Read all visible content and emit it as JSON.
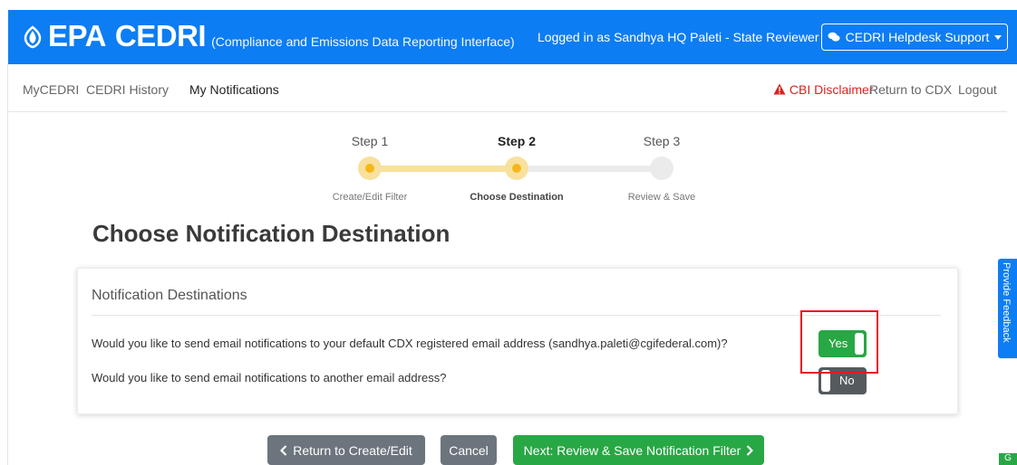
{
  "header": {
    "brand": "EPA",
    "app": "CEDRI",
    "tagline": "(Compliance and Emissions Data Reporting Interface)",
    "logged_in": "Logged in as Sandhya HQ Paleti - State Reviewer",
    "helpdesk": "CEDRI Helpdesk Support"
  },
  "nav": {
    "left": [
      "MyCEDRI",
      "CEDRI History",
      "My Notifications"
    ],
    "active": "My Notifications",
    "cbi": "CBI Disclaimer",
    "return": "Return to CDX",
    "logout": "Logout"
  },
  "stepper": {
    "steps": [
      {
        "label": "Step 1",
        "sub": "Create/Edit Filter",
        "state": "done"
      },
      {
        "label": "Step 2",
        "sub": "Choose Destination",
        "state": "active"
      },
      {
        "label": "Step 3",
        "sub": "Review & Save",
        "state": "todo"
      }
    ]
  },
  "page": {
    "title": "Choose Notification Destination"
  },
  "card": {
    "title": "Notification Destinations",
    "q1": "Would you like to send email notifications to your default CDX registered email address (sandhya.paleti@cgifederal.com)?",
    "q1_toggle": "Yes",
    "q2": "Would you like to send email notifications to another email address?",
    "q2_toggle": "No"
  },
  "buttons": {
    "back": "Return to Create/Edit",
    "cancel": "Cancel",
    "next": "Next: Review & Save Notification Filter"
  },
  "side": {
    "feedback": "Provide Feedback",
    "g": "G"
  },
  "colors": {
    "primary": "#0d7df3",
    "success": "#28a745",
    "secondary": "#6c757d",
    "danger": "#d9231f",
    "highlight": "#e8191b",
    "step_done": "#f8e19d",
    "step_dot": "#f5b81a"
  }
}
